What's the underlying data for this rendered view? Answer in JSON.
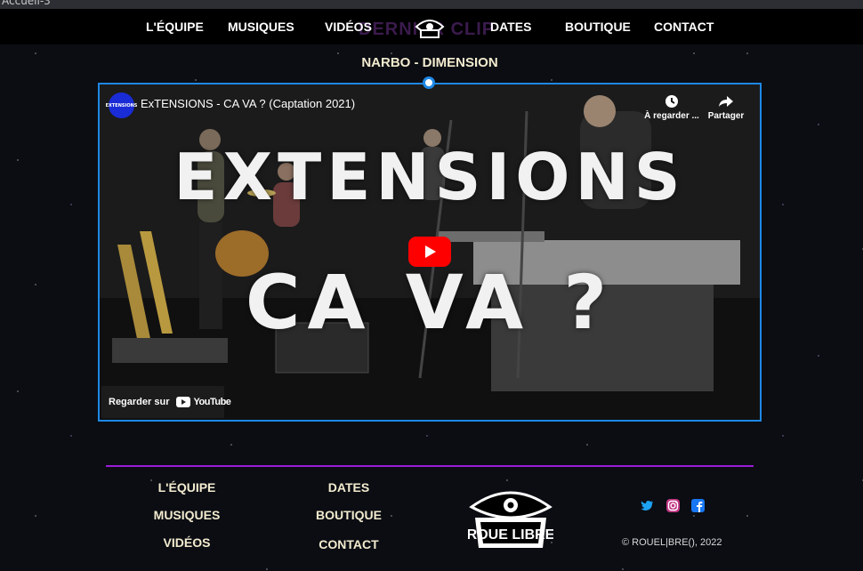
{
  "browser": {
    "tab_title": "Accueil-3"
  },
  "nav": {
    "ghost_heading": "DERNIER CLIP",
    "items": [
      {
        "label": "L'ÉQUIPE"
      },
      {
        "label": "MUSIQUES"
      },
      {
        "label": "VIDÉOS"
      },
      {
        "label": "DATES"
      },
      {
        "label": "BOUTIQUE"
      },
      {
        "label": "CONTACT"
      }
    ]
  },
  "section": {
    "title": "NARBO - DIMENSION"
  },
  "video": {
    "channel_badge": "EXTENSIONS",
    "title": "ExTENSIONS - CA VA ? (Captation 2021)",
    "watch_later": "À regarder ...",
    "share": "Partager",
    "overlay_line1": "EXTENSIONS",
    "overlay_line2": "CA VA ?",
    "watch_on": "Regarder sur",
    "youtube_word": "YouTube"
  },
  "footer": {
    "col1": [
      {
        "label": "L'ÉQUIPE"
      },
      {
        "label": "MUSIQUES"
      },
      {
        "label": "VIDÉOS"
      }
    ],
    "col2": [
      {
        "label": "DATES"
      },
      {
        "label": "BOUTIQUE"
      },
      {
        "label": "CONTACT"
      }
    ],
    "logo_text": "ROUE LIBRE",
    "social_icons": [
      "twitter-icon",
      "instagram-icon",
      "facebook-icon"
    ],
    "copyright": "© ROUEL|BRE(), 2022"
  },
  "colors": {
    "accent_blue": "#1e88e5",
    "divider_purple": "#9c1cd6",
    "youtube_red": "#ff0000",
    "footer_text": "#f3ebcf"
  }
}
